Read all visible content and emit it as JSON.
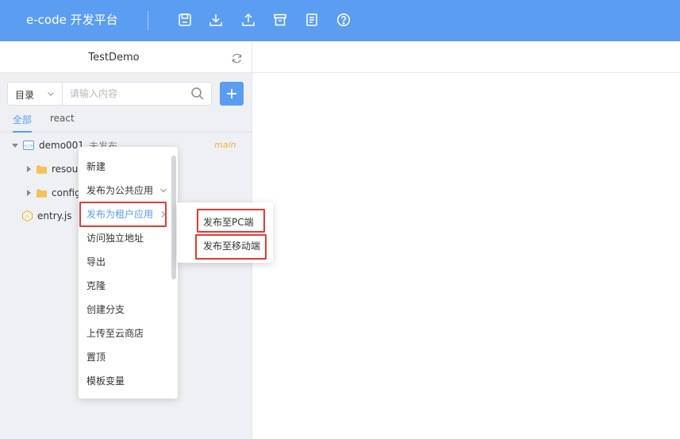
{
  "header": {
    "title": "e-code 开发平台",
    "icons": [
      "save-icon",
      "download-icon",
      "upload-icon",
      "archive-icon",
      "document-icon",
      "help-icon"
    ],
    "background": "#5b9df0"
  },
  "sidebar": {
    "project_name": "TestDemo",
    "search": {
      "directory_label": "目录",
      "placeholder": "请输入内容"
    },
    "tabs": [
      "全部",
      "react"
    ],
    "active_tab": "全部",
    "tree": {
      "root_label": "demo001",
      "root_status": "未发布",
      "root_branch": "main",
      "children": [
        "resour",
        "config"
      ],
      "file": "entry.js"
    }
  },
  "context_menu": {
    "items": [
      "新建",
      "发布为公共应用",
      "发布为租户应用",
      "访问独立地址",
      "导出",
      "克隆",
      "创建分支",
      "上传至云商店",
      "置顶",
      "模板变量"
    ],
    "highlighted_item": "发布为租户应用"
  },
  "submenu": {
    "items": [
      "发布至PC端",
      "发布至移动端"
    ]
  },
  "colors": {
    "accent": "#5b9df0",
    "branch_tag": "#f0b04a",
    "callout_box": "#e53935"
  }
}
